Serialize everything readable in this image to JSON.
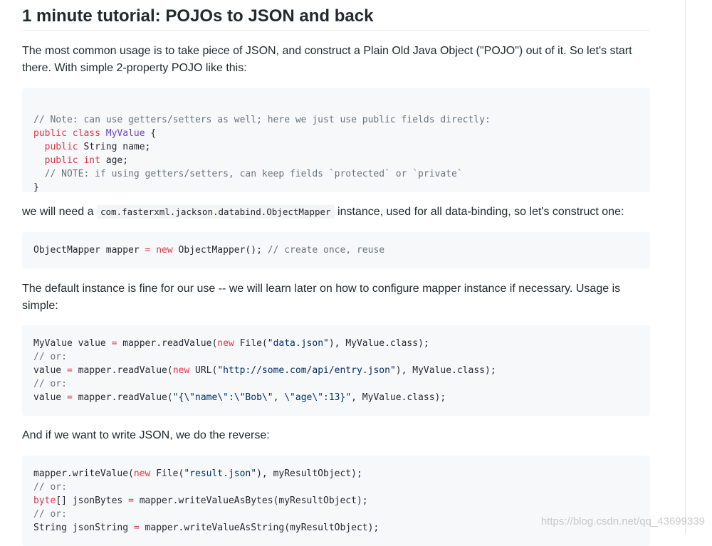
{
  "heading": "1 minute tutorial: POJOs to JSON and back",
  "para1": "The most common usage is to take piece of JSON, and construct a Plain Old Java Object (\"POJO\") out of it. So let's start there. With simple 2-property POJO like this:",
  "code1": {
    "line1": "// Note: can use getters/setters as well; here we just use public fields directly:",
    "l2_kw": "public class",
    "l2_cls": "MyValue",
    "l2_rest": " {",
    "l3_kw": "public",
    "l3_rest": " String name;",
    "l4_kw": "public int",
    "l4_rest": " age;",
    "line5": "// NOTE: if using getters/setters, can keep fields `protected` or `private`",
    "line6": "}"
  },
  "para2_before": "we will need a",
  "para2_code": "com.fasterxml.jackson.databind.ObjectMapper",
  "para2_after": "instance, used for all data-binding, so let's construct one:",
  "code2": {
    "a": "ObjectMapper mapper",
    "op": "=",
    "kw": "new",
    "b": "ObjectMapper();",
    "cm": "// create once, reuse"
  },
  "para3": "The default instance is fine for our use -- we will learn later on how to configure mapper instance if necessary. Usage is simple:",
  "code3": {
    "l1_a": "MyValue value",
    "l1_b": "mapper.readValue(",
    "l1_c": "File(",
    "l1_s": "\"data.json\"",
    "l1_d": "), MyValue.class);",
    "l2": "// or:",
    "l3_a": "value",
    "l3_b": "mapper.readValue(",
    "l3_c": "URL(",
    "l3_s": "\"http://some.com/api/entry.json\"",
    "l3_d": "), MyValue.class);",
    "l4": "// or:",
    "l5_a": "value",
    "l5_b": "mapper.readValue(",
    "l5_s": "\"{\\\"name\\\":\\\"Bob\\\", \\\"age\\\":13}\"",
    "l5_d": ", MyValue.class);",
    "op": "=",
    "kw": "new"
  },
  "para4": "And if we want to write JSON, we do the reverse:",
  "code4": {
    "l1_a": "mapper.writeValue(",
    "l1_kw": "new",
    "l1_b": "File(",
    "l1_s": "\"result.json\"",
    "l1_c": "), myResultObject);",
    "l2": "// or:",
    "l3_kw": "byte",
    "l3_a": "[] jsonBytes",
    "l3_op": "=",
    "l3_b": "mapper.writeValueAsBytes(myResultObject);",
    "l4": "// or:",
    "l5_a": "String jsonString",
    "l5_op": "=",
    "l5_b": "mapper.writeValueAsString(myResultObject);"
  },
  "watermark": "https://blog.csdn.net/qq_43699339"
}
